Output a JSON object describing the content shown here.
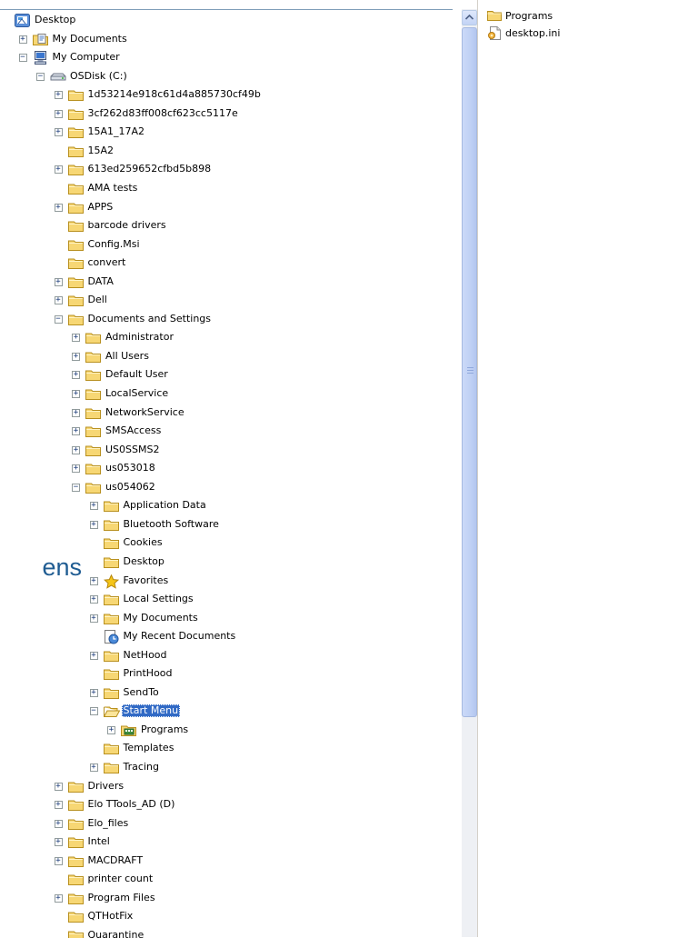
{
  "tree": [
    {
      "label": "Desktop",
      "depth": 0,
      "toggle": "none",
      "icon": "desktop-icon"
    },
    {
      "label": "My Documents",
      "depth": 1,
      "toggle": "plus",
      "icon": "my-documents-icon"
    },
    {
      "label": "My Computer",
      "depth": 1,
      "toggle": "minus",
      "icon": "my-computer-icon"
    },
    {
      "label": "OSDisk (C:)",
      "depth": 2,
      "toggle": "minus",
      "icon": "drive-icon"
    },
    {
      "label": "1d53214e918c61d4a885730cf49b",
      "depth": 3,
      "toggle": "plus",
      "icon": "folder-icon"
    },
    {
      "label": "3cf262d83ff008cf623cc5117e",
      "depth": 3,
      "toggle": "plus",
      "icon": "folder-icon"
    },
    {
      "label": "15A1_17A2",
      "depth": 3,
      "toggle": "plus",
      "icon": "folder-icon"
    },
    {
      "label": "15A2",
      "depth": 3,
      "toggle": "none",
      "icon": "folder-icon"
    },
    {
      "label": "613ed259652cfbd5b898",
      "depth": 3,
      "toggle": "plus",
      "icon": "folder-icon"
    },
    {
      "label": "AMA tests",
      "depth": 3,
      "toggle": "none",
      "icon": "folder-icon"
    },
    {
      "label": "APPS",
      "depth": 3,
      "toggle": "plus",
      "icon": "folder-icon"
    },
    {
      "label": "barcode drivers",
      "depth": 3,
      "toggle": "none",
      "icon": "folder-icon"
    },
    {
      "label": "Config.Msi",
      "depth": 3,
      "toggle": "none",
      "icon": "folder-icon"
    },
    {
      "label": "convert",
      "depth": 3,
      "toggle": "none",
      "icon": "folder-icon"
    },
    {
      "label": "DATA",
      "depth": 3,
      "toggle": "plus",
      "icon": "folder-icon"
    },
    {
      "label": "Dell",
      "depth": 3,
      "toggle": "plus",
      "icon": "folder-icon"
    },
    {
      "label": "Documents and Settings",
      "depth": 3,
      "toggle": "minus",
      "icon": "folder-icon"
    },
    {
      "label": "Administrator",
      "depth": 4,
      "toggle": "plus",
      "icon": "folder-icon"
    },
    {
      "label": "All Users",
      "depth": 4,
      "toggle": "plus",
      "icon": "folder-icon"
    },
    {
      "label": "Default User",
      "depth": 4,
      "toggle": "plus",
      "icon": "folder-icon"
    },
    {
      "label": "LocalService",
      "depth": 4,
      "toggle": "plus",
      "icon": "folder-icon"
    },
    {
      "label": "NetworkService",
      "depth": 4,
      "toggle": "plus",
      "icon": "folder-icon"
    },
    {
      "label": "SMSAccess",
      "depth": 4,
      "toggle": "plus",
      "icon": "folder-icon"
    },
    {
      "label": "US0SSMS2",
      "depth": 4,
      "toggle": "plus",
      "icon": "folder-icon"
    },
    {
      "label": "us053018",
      "depth": 4,
      "toggle": "plus",
      "icon": "folder-icon"
    },
    {
      "label": "us054062",
      "depth": 4,
      "toggle": "minus",
      "icon": "folder-icon"
    },
    {
      "label": "Application Data",
      "depth": 5,
      "toggle": "plus",
      "icon": "folder-icon"
    },
    {
      "label": "Bluetooth Software",
      "depth": 5,
      "toggle": "plus",
      "icon": "folder-icon"
    },
    {
      "label": "Cookies",
      "depth": 5,
      "toggle": "none",
      "icon": "folder-icon"
    },
    {
      "label": "Desktop",
      "depth": 5,
      "toggle": "none",
      "icon": "folder-icon"
    },
    {
      "label": "Favorites",
      "depth": 5,
      "toggle": "plus",
      "icon": "favorites-star-icon"
    },
    {
      "label": "Local Settings",
      "depth": 5,
      "toggle": "plus",
      "icon": "folder-icon"
    },
    {
      "label": "My Documents",
      "depth": 5,
      "toggle": "plus",
      "icon": "folder-icon"
    },
    {
      "label": "My Recent Documents",
      "depth": 5,
      "toggle": "none",
      "icon": "recent-documents-icon"
    },
    {
      "label": "NetHood",
      "depth": 5,
      "toggle": "plus",
      "icon": "folder-icon"
    },
    {
      "label": "PrintHood",
      "depth": 5,
      "toggle": "none",
      "icon": "folder-icon"
    },
    {
      "label": "SendTo",
      "depth": 5,
      "toggle": "plus",
      "icon": "folder-icon"
    },
    {
      "label": "Start Menu",
      "depth": 5,
      "toggle": "minus",
      "icon": "open-folder-icon",
      "selected": true
    },
    {
      "label": "Programs",
      "depth": 6,
      "toggle": "plus",
      "icon": "programs-folder-icon"
    },
    {
      "label": "Templates",
      "depth": 5,
      "toggle": "none",
      "icon": "folder-icon"
    },
    {
      "label": "Tracing",
      "depth": 5,
      "toggle": "plus",
      "icon": "folder-icon"
    },
    {
      "label": "Drivers",
      "depth": 3,
      "toggle": "plus",
      "icon": "folder-icon"
    },
    {
      "label": "Elo TTools_AD (D)",
      "depth": 3,
      "toggle": "plus",
      "icon": "folder-icon"
    },
    {
      "label": "Elo_files",
      "depth": 3,
      "toggle": "plus",
      "icon": "folder-icon"
    },
    {
      "label": "Intel",
      "depth": 3,
      "toggle": "plus",
      "icon": "folder-icon"
    },
    {
      "label": "MACDRAFT",
      "depth": 3,
      "toggle": "plus",
      "icon": "folder-icon"
    },
    {
      "label": "printer count",
      "depth": 3,
      "toggle": "none",
      "icon": "folder-icon"
    },
    {
      "label": "Program Files",
      "depth": 3,
      "toggle": "plus",
      "icon": "folder-icon"
    },
    {
      "label": "QTHotFix",
      "depth": 3,
      "toggle": "none",
      "icon": "folder-icon"
    },
    {
      "label": "Quarantine",
      "depth": 3,
      "toggle": "none",
      "icon": "folder-icon"
    }
  ],
  "content_pane": {
    "items": [
      {
        "label": "Programs",
        "icon": "folder-icon"
      },
      {
        "label": "desktop.ini",
        "icon": "ini-file-icon"
      }
    ]
  },
  "overlay_text": "ens",
  "colors": {
    "selection": "#316ac5",
    "folder": "#f7d774",
    "overlay_text": "#1f5c92"
  }
}
